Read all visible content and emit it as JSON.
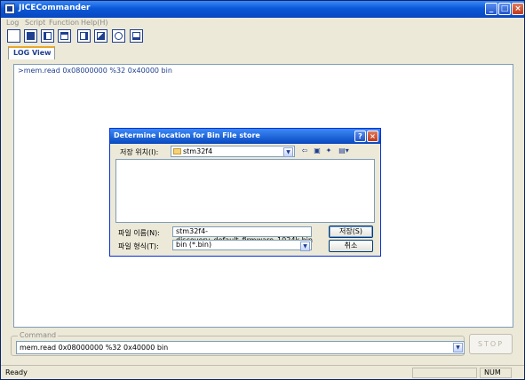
{
  "window": {
    "title": "JICECommander"
  },
  "menu": [
    "Log",
    "Script",
    "Function",
    "Help(H)"
  ],
  "toolbar": {
    "icons": [
      "new-icon",
      "save-icon",
      "script-icon",
      "list-icon",
      "d-icon",
      "image-icon",
      "target-icon",
      "window-icon"
    ]
  },
  "tabs": [
    {
      "label": "LOG View"
    }
  ],
  "log": {
    "lines": [
      ">mem.read 0x08000000 %32 0x40000 bin"
    ]
  },
  "command": {
    "legend": "Command",
    "value": "mem.read 0x08000000 %32 0x40000 bin",
    "stop_label": "STOP"
  },
  "status": {
    "text": "Ready",
    "num": "NUM"
  },
  "dialog": {
    "title": "Determine location for Bin File store",
    "help_glyph": "?",
    "close_glyph": "×",
    "lookin_label": "저장 위치(I):",
    "lookin_value": "stm32f4",
    "filename_label": "파일 이름(N):",
    "filename_value": "stm32f4-discovery_default_firmware_1024k.bin",
    "filetype_label": "파일 형식(T):",
    "filetype_value": "bin (*.bin)",
    "save_label": "저장(S)",
    "cancel_label": "취소"
  }
}
